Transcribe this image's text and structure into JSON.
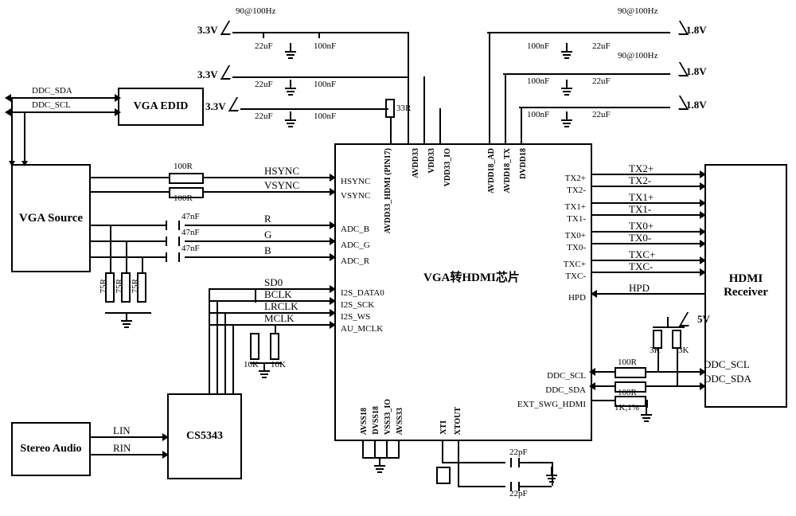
{
  "blocks": {
    "vga_source": "VGA\nSource",
    "vga_edid": "VGA EDID",
    "stereo_audio": "Stereo\nAudio",
    "cs5343": "CS5343",
    "hdmi_receiver": "HDMI\nReceiver",
    "chip": "VGA转HDMI芯片"
  },
  "power": {
    "v33": "3.3V",
    "v18": "1.8V",
    "v5": "5V",
    "ferrite": "90@100Hz"
  },
  "caps": {
    "uf22": "22uF",
    "nf100": "100nF",
    "nf47": "47nF",
    "pf22": "22pF"
  },
  "res": {
    "r33": "33R",
    "r100": "100R",
    "r75": "75R",
    "r10k": "10K",
    "r3k": "3K",
    "r1k1": "1K,1%"
  },
  "lines": {
    "ddc_sda": "DDC_SDA",
    "ddc_scl": "DDC_SCL",
    "hsync": "HSYNC",
    "vsync": "VSYNC",
    "r": "R",
    "g": "G",
    "b": "B",
    "sd0": "SD0",
    "bclk": "BCLK",
    "lrclk": "LRCLK",
    "mclk": "MCLK",
    "lin": "LIN",
    "rin": "RIN",
    "tx2p": "TX2+",
    "tx2n": "TX2-",
    "tx1p": "TX1+",
    "tx1n": "TX1-",
    "tx0p": "TX0+",
    "tx0n": "TX0-",
    "txcp": "TXC+",
    "txcn": "TXC-",
    "hpd": "HPD"
  },
  "chip_pins": {
    "top": [
      "AVDD33_HDMI\n(PIN17)",
      "AVDD33",
      "VDD33",
      "VDD33_IO",
      "AVDD18_AD",
      "AVDD18_TX",
      "DVDD18"
    ],
    "left_sync": [
      "HSYNC",
      "VSYNC"
    ],
    "left_adc": [
      "ADC_B",
      "ADC_G",
      "ADC_R"
    ],
    "left_i2s": [
      "I2S_DATA0",
      "I2S_SCK",
      "I2S_WS",
      "AU_MCLK"
    ],
    "right_tmds": [
      "TX2+",
      "TX2-",
      "TX1+",
      "TX1-",
      "TX0+",
      "TX0-",
      "TXC+",
      "TXC-"
    ],
    "right_hpd": "HPD",
    "right_ddc": [
      "DDC_SCL",
      "DDC_SDA",
      "EXT_SWG_HDMI"
    ],
    "bottom_vss": [
      "AVSS18",
      "DVSS18",
      "VSS33_IO",
      "AVSS33"
    ],
    "bottom_xt": [
      "XTI",
      "XTOUT"
    ]
  }
}
